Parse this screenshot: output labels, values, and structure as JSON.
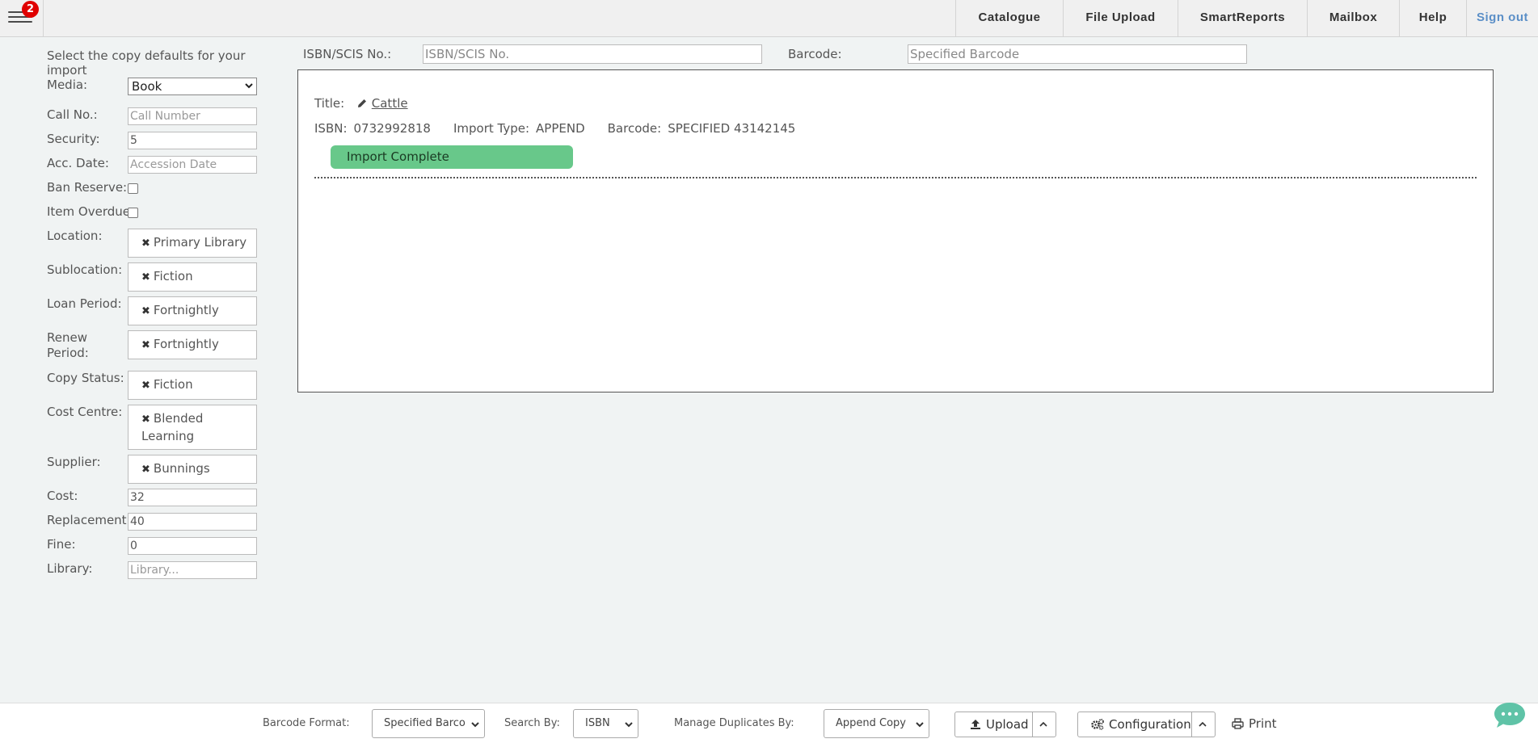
{
  "nav": {
    "badge_count": "2",
    "items": [
      "Catalogue",
      "File Upload",
      "SmartReports",
      "Mailbox",
      "Help"
    ],
    "signout": "Sign out"
  },
  "left": {
    "intro": "Select the copy defaults for your import",
    "media_label": "Media:",
    "media_value": "Book",
    "call_label": "Call No.:",
    "call_placeholder": "Call Number",
    "security_label": "Security:",
    "security_value": "5",
    "acc_label": "Acc. Date:",
    "acc_placeholder": "Accession Date",
    "ban_label": "Ban Reserve:",
    "overdue_label": "Item Overdue:",
    "location_label": "Location:",
    "location_value": "Primary Library",
    "sublocation_label": "Sublocation:",
    "sublocation_value": "Fiction",
    "loan_label": "Loan Period:",
    "loan_value": "Fortnightly",
    "renew_label": "Renew Period:",
    "renew_value": "Fortnightly",
    "copystatus_label": "Copy Status:",
    "copystatus_value": "Fiction",
    "costcentre_label": "Cost Centre:",
    "costcentre_value": "Blended Learning",
    "supplier_label": "Supplier:",
    "supplier_value": "Bunnings",
    "cost_label": "Cost:",
    "cost_value": "32",
    "replacement_label": "Replacement:",
    "replacement_value": "40",
    "fine_label": "Fine:",
    "fine_value": "0",
    "library_label": "Library:",
    "library_placeholder": "Library..."
  },
  "search": {
    "isbn_label": "ISBN/SCIS No.:",
    "isbn_placeholder": "ISBN/SCIS No.",
    "barcode_label": "Barcode:",
    "barcode_placeholder": "Specified Barcode"
  },
  "result": {
    "title_label": "Title:",
    "title_value": "Cattle",
    "isbn_label": "ISBN:",
    "isbn_value": "0732992818",
    "import_type_label": "Import Type:",
    "import_type_value": "APPEND",
    "barcode_label": "Barcode:",
    "barcode_value": "SPECIFIED 43142145",
    "status": "Import Complete"
  },
  "bottom": {
    "barcode_format_label": "Barcode Format:",
    "barcode_format_value": "Specified Barco",
    "search_by_label": "Search By:",
    "search_by_value": "ISBN",
    "duplicates_label": "Manage Duplicates By:",
    "duplicates_value": "Append Copy",
    "upload_label": "Upload",
    "configuration_label": "Configuration",
    "print_label": "Print"
  },
  "colors": {
    "accent_green": "#68c88a",
    "badge_red": "#e00000",
    "signout_blue": "#5b8fc7"
  }
}
